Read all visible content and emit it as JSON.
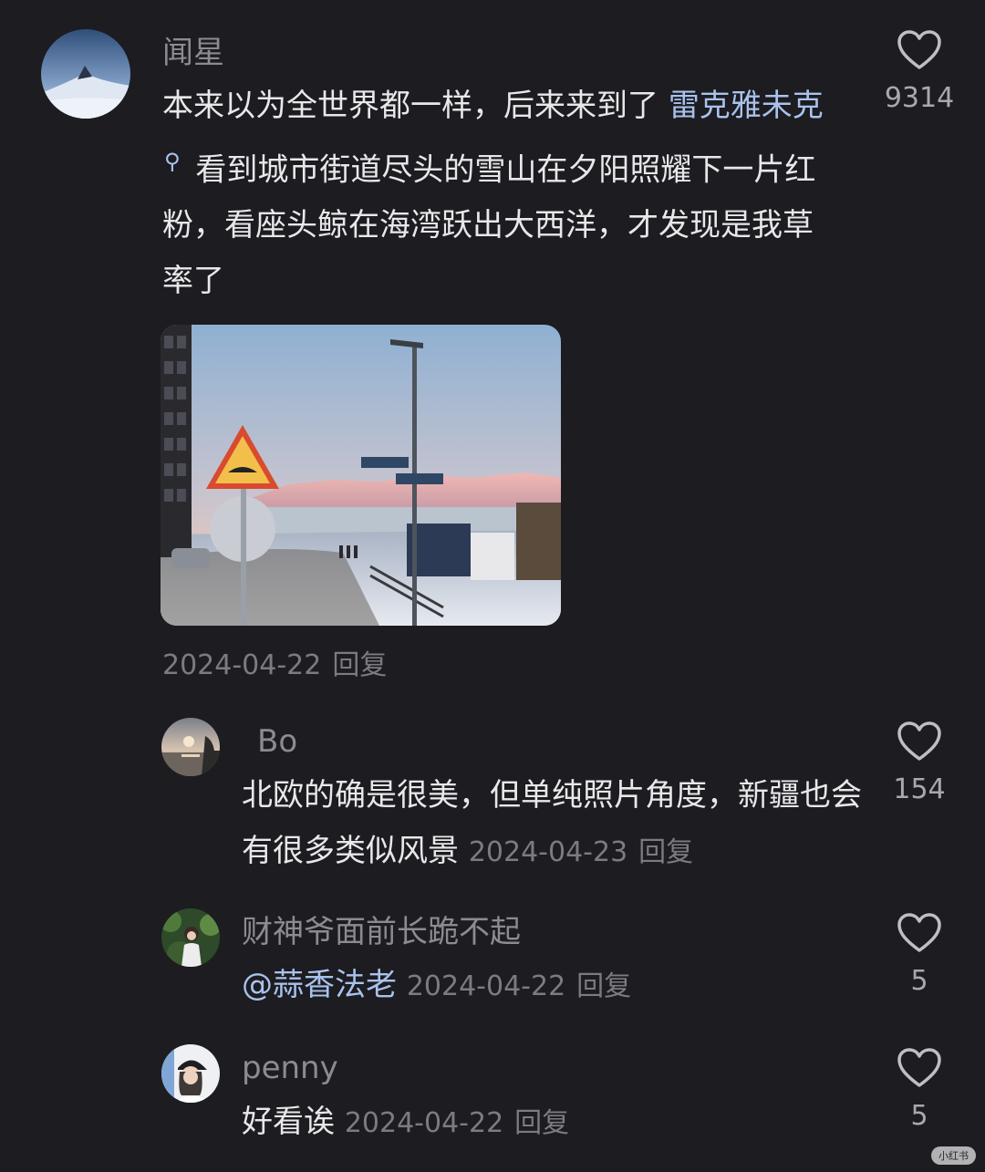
{
  "comments": [
    {
      "user": "闻星",
      "text_before_link": "本来以为全世界都一样，后来来到了 ",
      "link": "雷克雅未克",
      "text_after_link": " 看到城市街道尽头的雪山在夕阳照耀下一片红粉，看座头鲸在海湾跃出大西洋，才发现是我草率了",
      "date": "2024-04-22",
      "reply_label": "回复",
      "likes": "9314",
      "avatar_icon": "snowy-mountain-avatar",
      "image_icon": "reykjavik-street-photo"
    }
  ],
  "replies": [
    {
      "user": "Bo",
      "text": "北欧的确是很美，但单纯照片角度，新疆也会有很多类似风景",
      "date": "2024-04-23",
      "reply_label": "回复",
      "likes": "154",
      "avatar_icon": "sunset-sea-avatar"
    },
    {
      "user": "财神爷面前长跪不起",
      "mention": "@蒜香法老",
      "date": "2024-04-22",
      "reply_label": "回复",
      "likes": "5",
      "avatar_icon": "girl-forest-avatar"
    },
    {
      "user": "penny",
      "text": "好看诶",
      "date": "2024-04-22",
      "reply_label": "回复",
      "likes": "5",
      "avatar_icon": "girl-cap-avatar"
    }
  ],
  "watermark": "小红书",
  "colors": {
    "background": "#1c1c21",
    "link": "#a9c2ec",
    "muted": "#8b8b90"
  }
}
